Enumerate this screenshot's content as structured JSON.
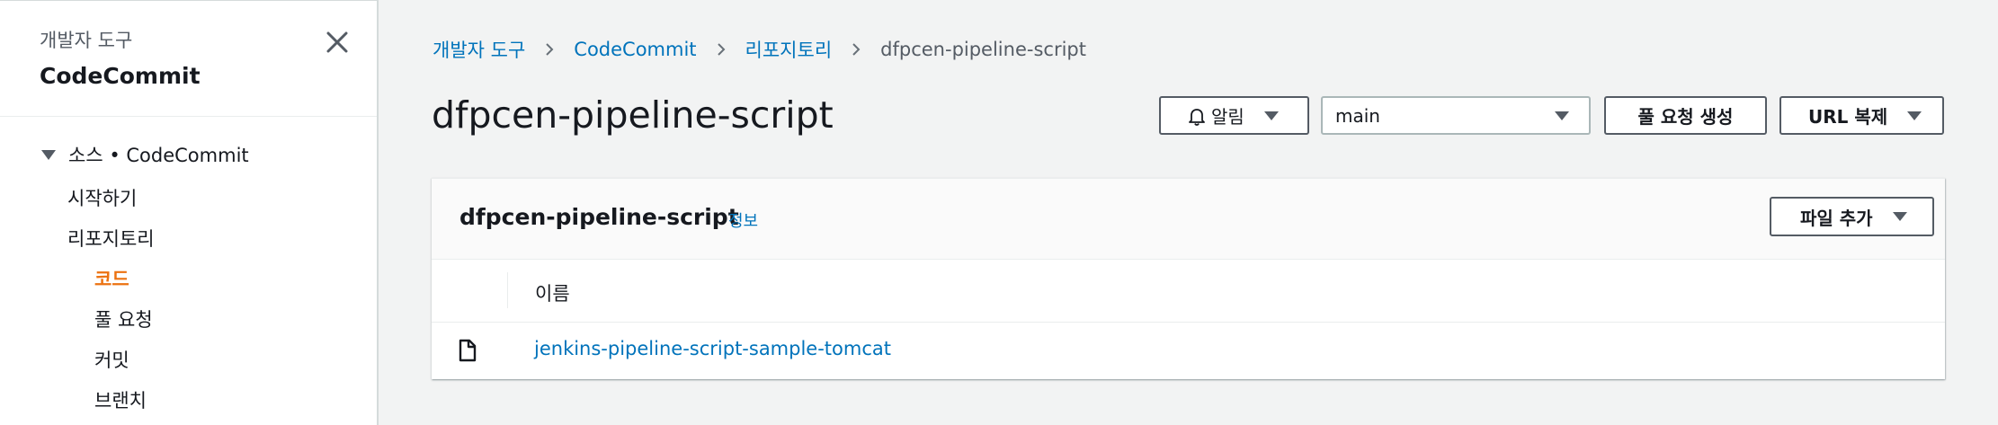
{
  "sidebar": {
    "kicker": "개발자 도구",
    "title": "CodeCommit",
    "section_label": "소스 • CodeCommit",
    "items": [
      {
        "label": "시작하기"
      },
      {
        "label": "리포지토리"
      },
      {
        "label": "코드",
        "active": true
      },
      {
        "label": "풀 요청"
      },
      {
        "label": "커밋"
      },
      {
        "label": "브랜치"
      }
    ]
  },
  "breadcrumb": [
    {
      "label": "개발자 도구"
    },
    {
      "label": "CodeCommit"
    },
    {
      "label": "리포지토리"
    },
    {
      "label": "dfpcen-pipeline-script"
    }
  ],
  "header": {
    "title": "dfpcen-pipeline-script",
    "notify_label": "알림",
    "branch_value": "main",
    "create_pr_label": "풀 요청 생성",
    "copy_url_label": "URL 복제"
  },
  "panel": {
    "title": "dfpcen-pipeline-script",
    "info_label": "정보",
    "add_file_label": "파일 추가",
    "column_name": "이름",
    "rows": [
      {
        "name": "jenkins-pipeline-script-sample-tomcat",
        "icon": "file-icon"
      }
    ]
  },
  "colors": {
    "link": "#0073bb",
    "active": "#ec7211",
    "background": "#f2f3f3",
    "text": "#16191f"
  }
}
